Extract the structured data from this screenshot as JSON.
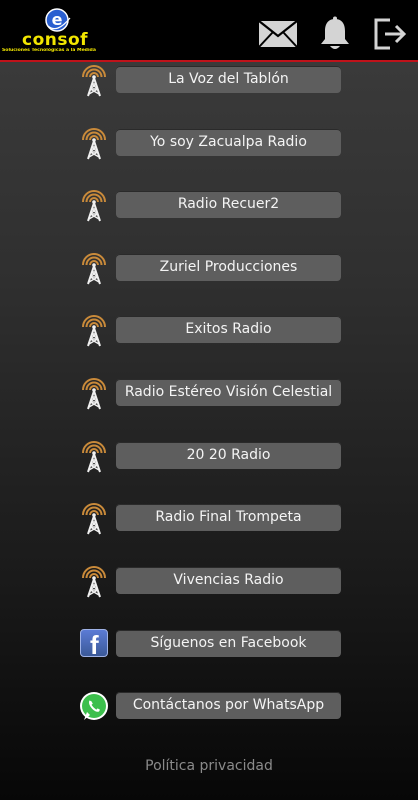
{
  "header": {
    "logo_letter": "e",
    "logo_word": "consof",
    "logo_tagline": "Soluciones Tecnológicas a la Medida",
    "icons": [
      "mail-icon",
      "bell-icon",
      "logout-icon"
    ]
  },
  "stations": [
    {
      "label": "La Voz del Tablón",
      "icon": "radio-tower-icon"
    },
    {
      "label": "Yo soy Zacualpa Radio",
      "icon": "radio-tower-icon"
    },
    {
      "label": "Radio Recuer2",
      "icon": "radio-tower-icon"
    },
    {
      "label": "Zuriel Producciones",
      "icon": "radio-tower-icon"
    },
    {
      "label": "Exitos Radio",
      "icon": "radio-tower-icon"
    },
    {
      "label": "Radio Estéreo Visión Celestial",
      "icon": "radio-tower-icon"
    },
    {
      "label": "20 20 Radio",
      "icon": "radio-tower-icon"
    },
    {
      "label": "Radio Final Trompeta",
      "icon": "radio-tower-icon"
    },
    {
      "label": "Vivencias Radio",
      "icon": "radio-tower-icon"
    }
  ],
  "social": {
    "facebook_label": "Síguenos en Facebook",
    "facebook_icon": "facebook-icon",
    "whatsapp_label": "Contáctanos por WhatsApp",
    "whatsapp_icon": "whatsapp-icon"
  },
  "footer": {
    "privacy_label": "Política privacidad"
  },
  "colors": {
    "accent_red": "#c0121a",
    "logo_yellow": "#f2e600",
    "button_gray": "#5e5e5e",
    "tower_orange": "#c98a3a"
  }
}
